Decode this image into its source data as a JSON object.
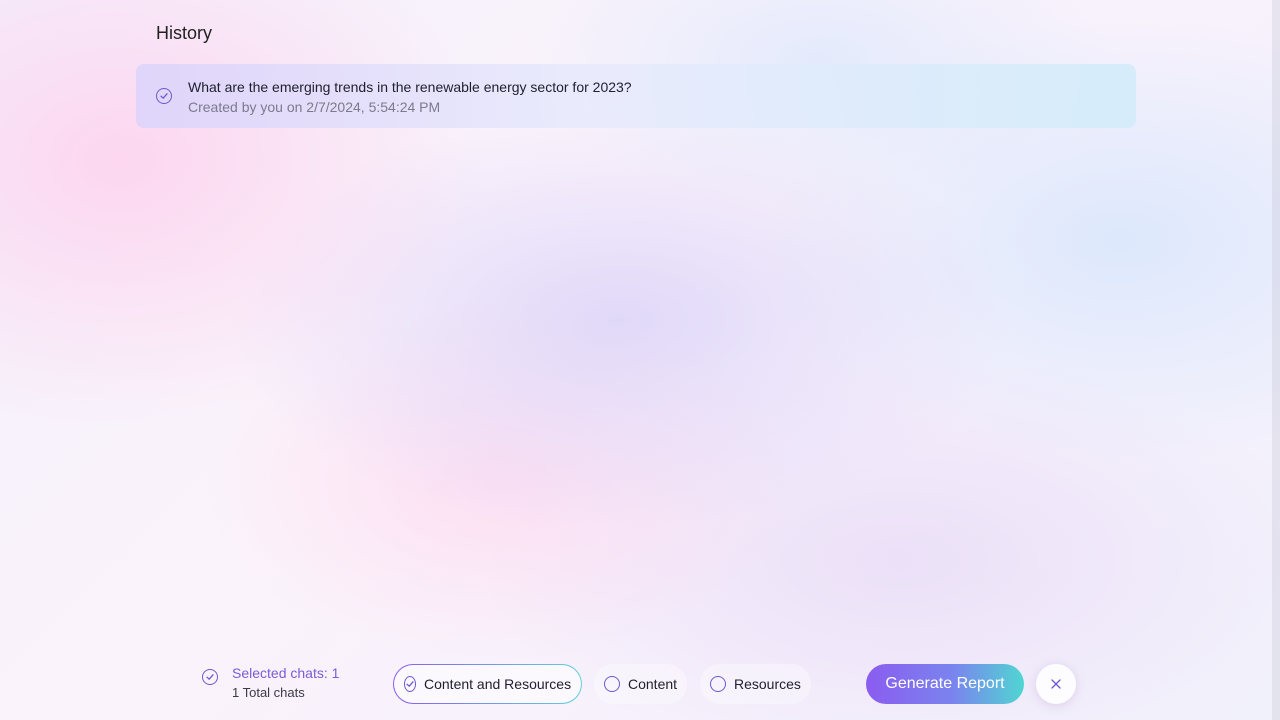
{
  "page": {
    "title": "History"
  },
  "history": {
    "items": [
      {
        "title": "What are the emerging trends in the renewable energy sector for 2023?",
        "subtitle": "Created by you on 2/7/2024, 5:54:24 PM",
        "selected": true
      }
    ]
  },
  "footer": {
    "selected_label": "Selected chats: 1",
    "total_label": "1 Total chats",
    "options": [
      {
        "label": "Content and Resources",
        "selected": true
      },
      {
        "label": "Content",
        "selected": false
      },
      {
        "label": "Resources",
        "selected": false
      }
    ],
    "generate_label": "Generate Report",
    "close_icon": "close-icon"
  },
  "colors": {
    "accent": "#6a5acd",
    "selected_text": "#7b5cd6",
    "button_gradient_start": "#8b5cf0",
    "button_gradient_end": "#4fd6d2"
  }
}
